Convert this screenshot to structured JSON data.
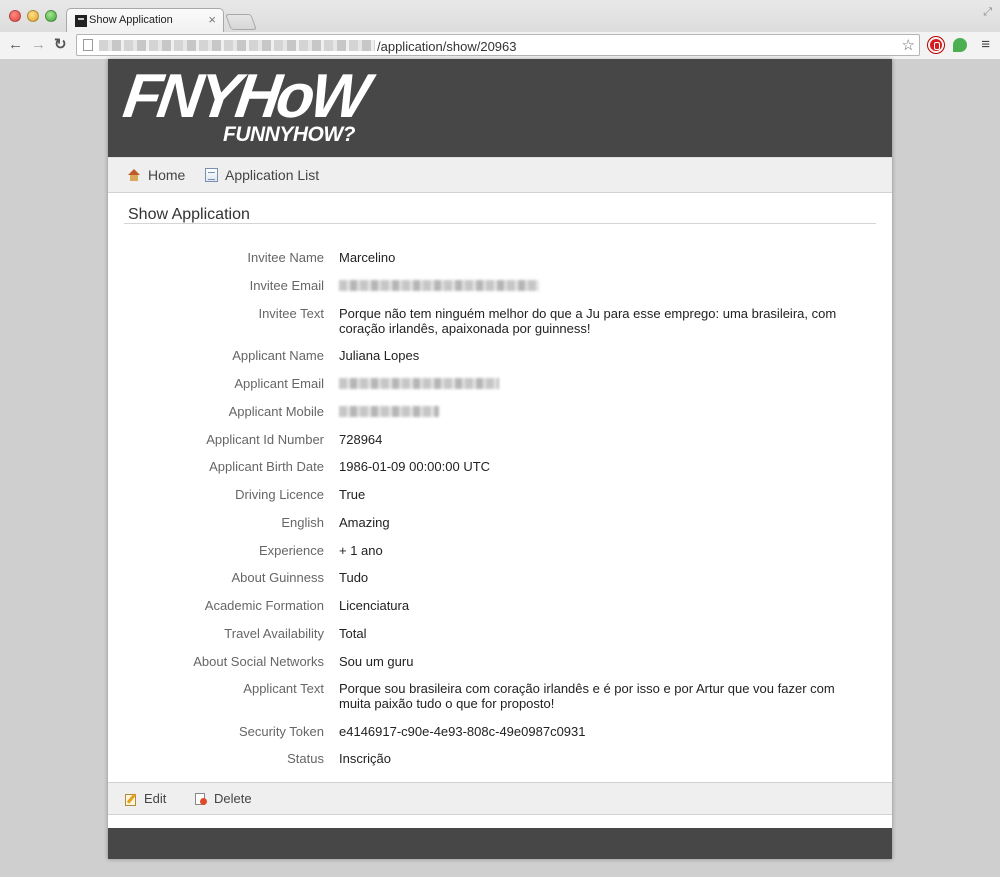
{
  "browser": {
    "tab_title": "Show Application",
    "tab_close": "×",
    "url_path": "/application/show/20963",
    "back": "←",
    "forward": "→",
    "reload": "↻",
    "star": "☆",
    "menu": "≡",
    "fullscreen": "⤢"
  },
  "header": {
    "logo_main": "FNYHoW",
    "logo_sub": "FUNNYHOW?"
  },
  "nav": {
    "home": "Home",
    "application_list": "Application List"
  },
  "section": {
    "title": "Show Application"
  },
  "fields": [
    {
      "label": "Invitee Name",
      "value": "Marcelino"
    },
    {
      "label": "Invitee Email",
      "value": ""
    },
    {
      "label": "Invitee Text",
      "value": "Porque não tem ninguém melhor do que a Ju para esse emprego: uma brasileira, com coração irlandês, apaixonada por guinness!"
    },
    {
      "label": "Applicant Name",
      "value": "Juliana Lopes"
    },
    {
      "label": "Applicant Email",
      "value": ""
    },
    {
      "label": "Applicant Mobile",
      "value": ""
    },
    {
      "label": "Applicant Id Number",
      "value": "728964"
    },
    {
      "label": "Applicant Birth Date",
      "value": "1986-01-09 00:00:00 UTC"
    },
    {
      "label": "Driving Licence",
      "value": "True"
    },
    {
      "label": "English",
      "value": "Amazing"
    },
    {
      "label": "Experience",
      "value": "+ 1 ano"
    },
    {
      "label": "About Guinness",
      "value": "Tudo"
    },
    {
      "label": "Academic Formation",
      "value": "Licenciatura"
    },
    {
      "label": "Travel Availability",
      "value": "Total"
    },
    {
      "label": "About Social Networks",
      "value": "Sou um guru"
    },
    {
      "label": "Applicant Text",
      "value": "Porque sou brasileira com coração irlandês e é por isso e por Artur que vou fazer com muita paixão tudo o que for proposto!"
    },
    {
      "label": "Security Token",
      "value": "e4146917-c90e-4e93-808c-49e0987c0931"
    },
    {
      "label": "Status",
      "value": "Inscrição"
    }
  ],
  "actions": {
    "edit": "Edit",
    "delete": "Delete"
  }
}
